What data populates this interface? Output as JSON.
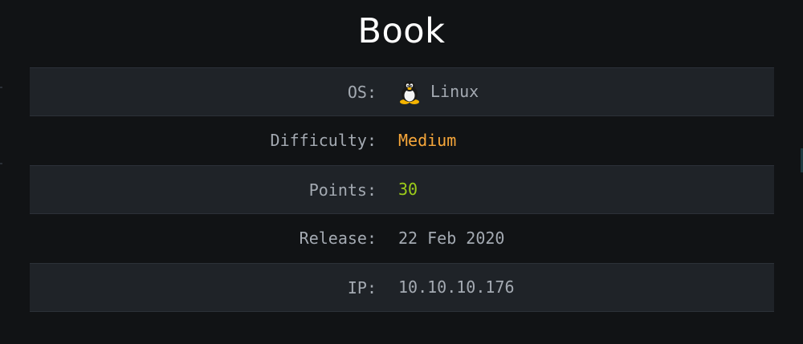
{
  "page": {
    "title": "Book"
  },
  "rows": [
    {
      "label": "OS:",
      "value": "Linux",
      "value_color": "#a4aab2",
      "icon": "linux-penguin-icon"
    },
    {
      "label": "Difficulty:",
      "value": "Medium",
      "value_color": "#f7a73a"
    },
    {
      "label": "Points:",
      "value": "30",
      "value_color": "#9ccc1a"
    },
    {
      "label": "Release:",
      "value": "22 Feb 2020",
      "value_color": "#a4aab2"
    },
    {
      "label": "IP:",
      "value": "10.10.10.176",
      "value_color": "#a4aab2"
    }
  ],
  "colors": {
    "background": "#111315",
    "row_stripe": "#1f2328",
    "label": "#a4aab2",
    "title": "#ffffff"
  }
}
